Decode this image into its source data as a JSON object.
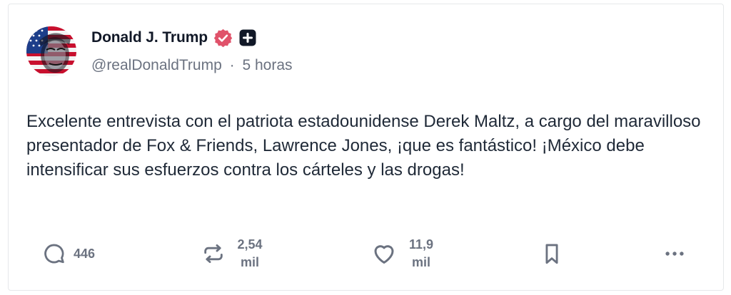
{
  "post": {
    "author": {
      "name": "Donald J. Trump",
      "handle": "@realDonaldTrump",
      "separator": "·",
      "time": "5 horas"
    },
    "text": "Excelente entrevista con el patriota estadounidense Derek Maltz, a cargo del maravilloso presentador de Fox & Friends, Lawrence Jones, ¡que es fantástico! ¡México debe intensificar sus esfuerzos contra los cárteles y las drogas!",
    "actions": {
      "replies": "446",
      "reposts_num": "2,54",
      "reposts_unit": "mil",
      "likes_num": "11,9",
      "likes_unit": "mil"
    }
  },
  "icons": {
    "verified": "verified-badge-icon",
    "plus": "plus-badge-icon",
    "reply": "comment-bubble-icon",
    "repost": "repost-arrows-icon",
    "like": "heart-icon",
    "bookmark": "bookmark-icon",
    "more": "more-dots-icon"
  },
  "colors": {
    "verified": "#e0526a",
    "icon": "#6b7280",
    "text": "#1f2937",
    "secondary": "#6b7280",
    "border": "#e6e8ea"
  }
}
